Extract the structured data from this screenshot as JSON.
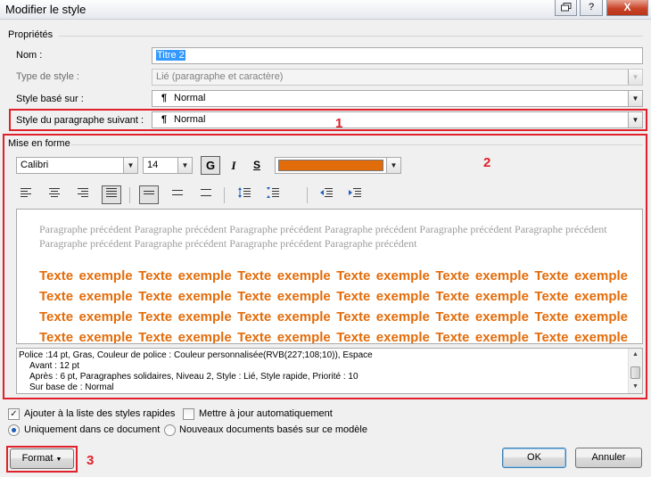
{
  "window": {
    "title": "Modifier le style",
    "help_btn": "?",
    "close_btn": "X"
  },
  "properties": {
    "group_label": "Propriétés",
    "name_label": "Nom :",
    "name_value": "Titre 2",
    "type_label": "Type de style :",
    "type_value": "Lié (paragraphe et caractère)",
    "based_label": "Style basé sur :",
    "based_value": "Normal",
    "next_label": "Style du paragraphe suivant :",
    "next_value": "Normal",
    "pilcrow": "¶"
  },
  "formatting": {
    "group_label": "Mise en forme",
    "font": "Calibri",
    "size": "14",
    "bold": "G",
    "italic": "I",
    "underline": "S",
    "color": "#e36c0a"
  },
  "annotations": {
    "one": "1",
    "two": "2",
    "three": "3"
  },
  "preview": {
    "previous": "Paragraphe précédent Paragraphe précédent Paragraphe précédent Paragraphe précédent Paragraphe précédent Paragraphe précédent Paragraphe précédent Paragraphe précédent Paragraphe précédent Paragraphe précédent",
    "sample": "Texte exemple Texte exemple Texte exemple Texte exemple Texte exemple Texte exemple Texte exemple Texte exemple Texte exemple Texte exemple Texte exemple Texte exemple Texte exemple Texte exemple Texte exemple Texte exemple Texte exemple Texte exemple Texte exemple Texte exemple Texte exemple Texte exemple Texte exemple Texte exemple Texte exemple Texte exemple Texte exemple Texte exemple Texte exemple Texte exemple Texte exemple"
  },
  "description": {
    "line1": "Police :14 pt, Gras, Couleur de police : Couleur personnalisée(RVB(227;108;10)), Espace",
    "line2": "Avant : 12 pt",
    "line3": "Après : 6 pt, Paragraphes solidaires, Niveau 2, Style : Lié, Style rapide, Priorité : 10",
    "line4": "Sur base de : Normal"
  },
  "options": {
    "add_quick": "Ajouter à la liste des styles rapides",
    "auto_update": "Mettre à jour automatiquement",
    "this_doc": "Uniquement dans ce document",
    "new_docs": "Nouveaux documents basés sur ce modèle"
  },
  "buttons": {
    "format": "Format",
    "ok": "OK",
    "cancel": "Annuler"
  }
}
